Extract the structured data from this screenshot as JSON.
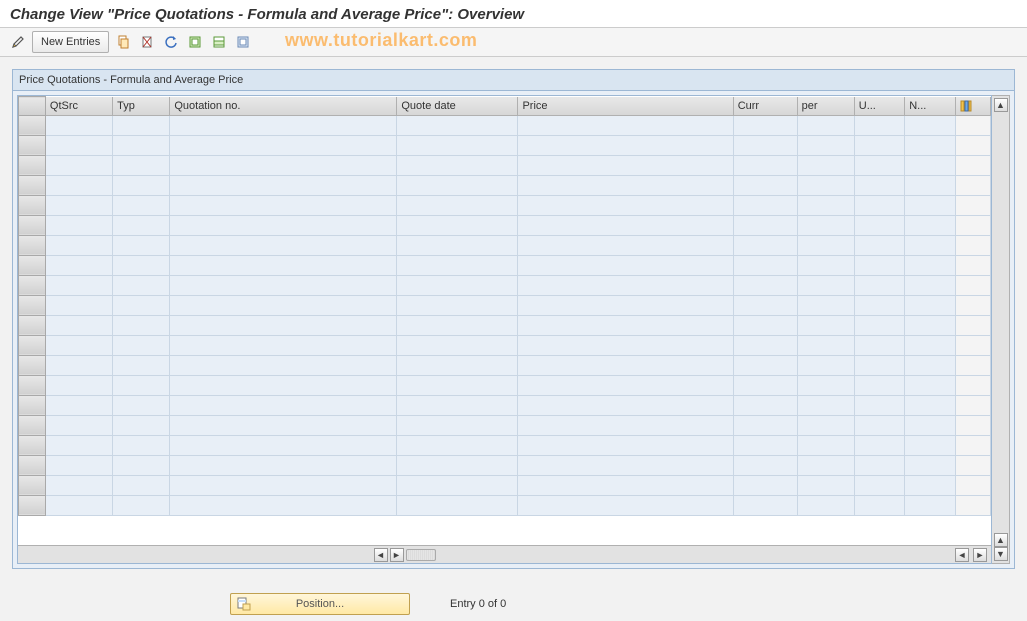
{
  "title": "Change View \"Price Quotations - Formula and Average Price\": Overview",
  "toolbar": {
    "new_entries": "New Entries"
  },
  "watermark": "www.tutorialkart.com",
  "panel": {
    "title": "Price Quotations - Formula and Average Price",
    "columns": [
      "QtSrc",
      "Typ",
      "Quotation no.",
      "Quote date",
      "Price",
      "Curr",
      "per",
      "U...",
      "N..."
    ]
  },
  "footer": {
    "position_label": "Position...",
    "entry_text": "Entry 0 of 0"
  }
}
